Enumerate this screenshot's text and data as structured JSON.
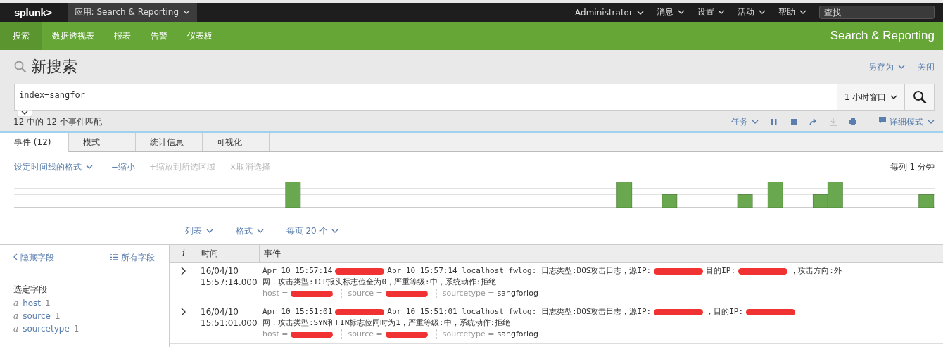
{
  "top_bar": {
    "logo": "splunk>",
    "app_menu": "应用: Search & Reporting",
    "menus": [
      "Administrator",
      "消息",
      "设置",
      "活动",
      "帮助"
    ],
    "search": {
      "placeholder": "查找"
    }
  },
  "nav": {
    "items": [
      {
        "label": "搜索",
        "selected": true
      },
      {
        "label": "数据透视表",
        "selected": false
      },
      {
        "label": "报表",
        "selected": false
      },
      {
        "label": "告警",
        "selected": false
      },
      {
        "label": "仪表板",
        "selected": false
      }
    ],
    "app_title": "Search & Reporting"
  },
  "search": {
    "title": "新搜索",
    "actions": [
      {
        "label": "另存为",
        "dropdown": true
      },
      {
        "label": "关闭",
        "dropdown": false
      }
    ],
    "query": "index=sangfor",
    "time_range": "1 小时窗口",
    "match_count": "12 中的 12 个事件匹配",
    "job_menu": "任务",
    "mode": "详细模式"
  },
  "tabs": [
    {
      "label": "事件 (12)",
      "selected": true
    },
    {
      "label": "模式",
      "selected": false
    },
    {
      "label": "统计信息",
      "selected": false
    },
    {
      "label": "可视化",
      "selected": false
    }
  ],
  "timeline": {
    "format_menu": "设定时间线的格式",
    "actions": [
      {
        "icon": "−",
        "label": "缩小",
        "disabled": false
      },
      {
        "icon": "+",
        "label": "缩放到所选区域",
        "disabled": true
      },
      {
        "icon": "×",
        "label": "取消选择",
        "disabled": true
      }
    ],
    "scale": "每列 1 分钟"
  },
  "results_controls": [
    "列表",
    "格式",
    "每页 20 个"
  ],
  "sidebar": {
    "hide_fields": "隐藏字段",
    "all_fields": "所有字段",
    "selected_heading": "选定字段",
    "fields": [
      {
        "type_glyph": "a",
        "name": "host",
        "count": "1"
      },
      {
        "type_glyph": "a",
        "name": "source",
        "count": "1"
      },
      {
        "type_glyph": "a",
        "name": "sourcetype",
        "count": "1"
      }
    ]
  },
  "table": {
    "columns": [
      "i",
      "时间",
      "事件"
    ],
    "rows": [
      {
        "date": "16/04/10",
        "time": "15:57:14.000",
        "lines": [
          [
            {
              "kind": "text",
              "text": "Apr 10 15:57:14"
            },
            {
              "kind": "redacted"
            },
            {
              "kind": "text",
              "text": "Apr 10 15:57:14 localhost fwlog: 日志类型:DOS攻击日志，源IP:"
            },
            {
              "kind": "redacted"
            },
            {
              "kind": "text",
              "text": "目的IP:"
            },
            {
              "kind": "redacted"
            },
            {
              "kind": "text",
              "text": "，攻击方向:外"
            }
          ],
          [
            {
              "kind": "text",
              "text": "网，攻击类型:TCP报头标志位全为0，严重等级:中，系统动作:拒绝"
            }
          ]
        ],
        "fields": [
          {
            "key": "host =",
            "kind": "redacted"
          },
          {
            "key": "source =",
            "kind": "redacted"
          },
          {
            "key": "sourcetype =",
            "kind": "text",
            "value": "sangforlog"
          }
        ]
      },
      {
        "date": "16/04/10",
        "time": "15:51:01.000",
        "lines": [
          [
            {
              "kind": "text",
              "text": "Apr 10 15:51:01"
            },
            {
              "kind": "redacted"
            },
            {
              "kind": "text",
              "text": "Apr 10 15:51:01 localhost fwlog: 日志类型:DOS攻击日志，源IP:"
            },
            {
              "kind": "redacted"
            },
            {
              "kind": "text",
              "text": "，目的IP:"
            },
            {
              "kind": "redacted"
            }
          ],
          [
            {
              "kind": "text",
              "text": "网，攻击类型:SYN和FIN标志位同时为1，严重等级:中，系统动作:拒绝"
            }
          ]
        ],
        "fields": [
          {
            "key": "host =",
            "kind": "redacted"
          },
          {
            "key": "source =",
            "kind": "redacted"
          },
          {
            "key": "sourcetype =",
            "kind": "text",
            "value": "sangforlog"
          }
        ]
      }
    ]
  }
}
